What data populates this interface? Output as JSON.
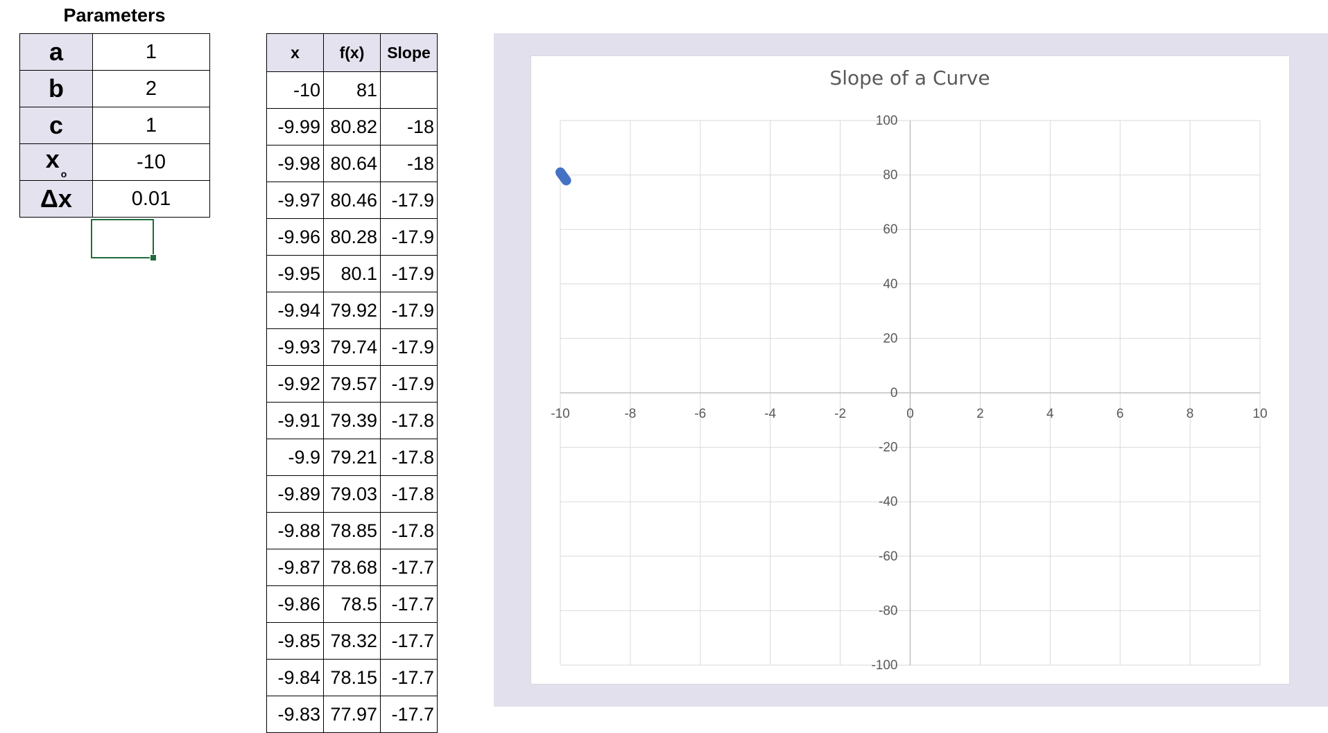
{
  "parameters": {
    "title": "Parameters",
    "rows": [
      {
        "label": "a",
        "value": "1"
      },
      {
        "label": "b",
        "value": "2"
      },
      {
        "label": "c",
        "value": "1"
      },
      {
        "label": "x",
        "subscript": "o",
        "value": "-10"
      },
      {
        "label": "Δx",
        "value": "0.01"
      }
    ]
  },
  "table": {
    "headers": [
      "x",
      "f(x)",
      "Slope"
    ],
    "rows": [
      [
        "-10",
        "81",
        ""
      ],
      [
        "-9.99",
        "80.82",
        "-18"
      ],
      [
        "-9.98",
        "80.64",
        "-18"
      ],
      [
        "-9.97",
        "80.46",
        "-17.9"
      ],
      [
        "-9.96",
        "80.28",
        "-17.9"
      ],
      [
        "-9.95",
        "80.1",
        "-17.9"
      ],
      [
        "-9.94",
        "79.92",
        "-17.9"
      ],
      [
        "-9.93",
        "79.74",
        "-17.9"
      ],
      [
        "-9.92",
        "79.57",
        "-17.9"
      ],
      [
        "-9.91",
        "79.39",
        "-17.8"
      ],
      [
        "-9.9",
        "79.21",
        "-17.8"
      ],
      [
        "-9.89",
        "79.03",
        "-17.8"
      ],
      [
        "-9.88",
        "78.85",
        "-17.8"
      ],
      [
        "-9.87",
        "78.68",
        "-17.7"
      ],
      [
        "-9.86",
        "78.5",
        "-17.7"
      ],
      [
        "-9.85",
        "78.32",
        "-17.7"
      ],
      [
        "-9.84",
        "78.15",
        "-17.7"
      ],
      [
        "-9.83",
        "77.97",
        "-17.7"
      ]
    ]
  },
  "chart_data": {
    "type": "scatter",
    "title": "Slope of a Curve",
    "xlabel": "",
    "ylabel": "",
    "xlim": [
      -10,
      10
    ],
    "ylim": [
      -100,
      100
    ],
    "x_ticks": [
      -10,
      -8,
      -6,
      -4,
      -2,
      0,
      2,
      4,
      6,
      8,
      10
    ],
    "y_ticks": [
      -100,
      -80,
      -60,
      -40,
      -20,
      0,
      20,
      40,
      60,
      80,
      100
    ],
    "grid": true,
    "legend": "none",
    "series": [
      {
        "color": "#4472c4",
        "x": [
          -10,
          -9.99,
          -9.98,
          -9.97,
          -9.96,
          -9.95,
          -9.94,
          -9.93,
          -9.92,
          -9.91,
          -9.9,
          -9.89,
          -9.88,
          -9.87,
          -9.86,
          -9.85,
          -9.84,
          -9.83
        ],
        "y": [
          81,
          80.82,
          80.64,
          80.46,
          80.28,
          80.1,
          79.92,
          79.74,
          79.57,
          79.39,
          79.21,
          79.03,
          78.85,
          78.68,
          78.5,
          78.32,
          78.15,
          77.97
        ]
      }
    ]
  },
  "colors": {
    "header_fill": "#e3e2ee",
    "chart_area": "#e2e0ed",
    "selection": "#1e6b3c",
    "series": "#4472c4"
  }
}
